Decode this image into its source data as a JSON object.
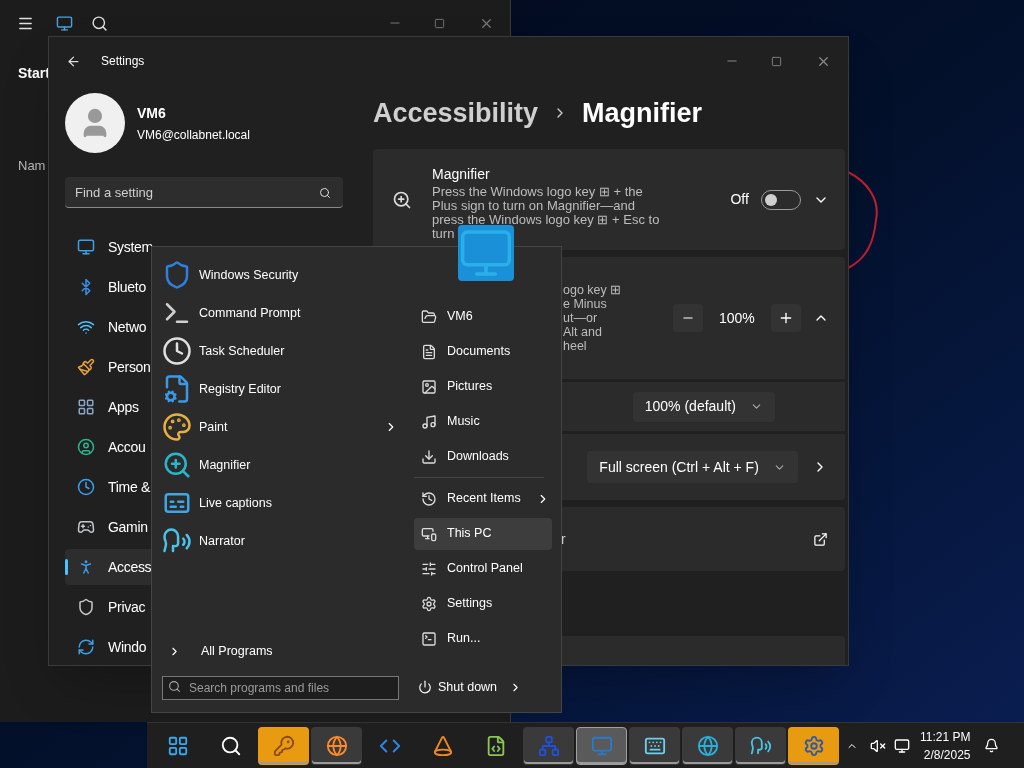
{
  "back_window": {
    "nav_heading": "Start",
    "column_heading": "Nam"
  },
  "settings": {
    "title": "Settings",
    "user": {
      "name": "VM6",
      "email": "VM6@collabnet.local"
    },
    "search": {
      "placeholder": "Find a setting"
    },
    "nav": [
      {
        "label": "System",
        "kind": "system",
        "selected": false
      },
      {
        "label": "Blueto",
        "kind": "bluetooth",
        "selected": false
      },
      {
        "label": "Netwo",
        "kind": "network",
        "selected": false
      },
      {
        "label": "Person",
        "kind": "brush",
        "selected": false
      },
      {
        "label": "Apps",
        "kind": "apps",
        "selected": false
      },
      {
        "label": "Accou",
        "kind": "account",
        "selected": false
      },
      {
        "label": "Time &",
        "kind": "time",
        "selected": false
      },
      {
        "label": "Gamin",
        "kind": "gaming",
        "selected": false
      },
      {
        "label": "Access",
        "kind": "accessibility",
        "selected": true
      },
      {
        "label": "Privac",
        "kind": "privacy",
        "selected": false
      },
      {
        "label": "Windo",
        "kind": "update",
        "selected": false
      }
    ],
    "breadcrumb": [
      "Accessibility",
      "Magnifier"
    ],
    "magnifier_card": {
      "title": "Magnifier",
      "description": "Press the Windows logo key ⊞ + the Plus sign to turn on Magnifier—and press the Windows logo key ⊞ + Esc to turn",
      "toggle_label": "Off",
      "on": false,
      "expanded": false
    },
    "zoom_card": {
      "description_lines": [
        "ogo key ⊞",
        "e Minus",
        "ut—or",
        "Alt and",
        "heel"
      ],
      "zoom_level": "100%",
      "expanded": true
    },
    "zoom_increment": {
      "value": "100% (default)"
    },
    "view": {
      "value": "Full screen (Ctrl + Alt + F)"
    },
    "link_card": {
      "label": "r"
    }
  },
  "start_menu": {
    "programs": [
      {
        "label": "Windows Security",
        "kind": "shield",
        "submenu": false
      },
      {
        "label": "Command Prompt",
        "kind": "console",
        "submenu": false
      },
      {
        "label": "Task Scheduler",
        "kind": "clock",
        "submenu": false
      },
      {
        "label": "Registry Editor",
        "kind": "registry",
        "submenu": false
      },
      {
        "label": "Paint",
        "kind": "palette",
        "submenu": true
      },
      {
        "label": "Magnifier",
        "kind": "magnifier",
        "submenu": false
      },
      {
        "label": "Live captions",
        "kind": "captions",
        "submenu": false
      },
      {
        "label": "Narrator",
        "kind": "narrator",
        "submenu": false
      }
    ],
    "all_programs": "All Programs",
    "search": {
      "placeholder": "Search programs and files"
    },
    "places": [
      {
        "label": "VM6",
        "kind": "user-folder",
        "submenu": false,
        "selected": false
      },
      {
        "label": "Documents",
        "kind": "document",
        "submenu": false,
        "selected": false
      },
      {
        "label": "Pictures",
        "kind": "picture",
        "submenu": false,
        "selected": false
      },
      {
        "label": "Music",
        "kind": "music",
        "submenu": false,
        "selected": false
      },
      {
        "label": "Downloads",
        "kind": "download",
        "submenu": false,
        "selected": false
      }
    ],
    "system_places": [
      {
        "label": "Recent Items",
        "kind": "recent",
        "submenu": true,
        "selected": false
      },
      {
        "label": "This PC",
        "kind": "computer",
        "submenu": false,
        "selected": true
      },
      {
        "label": "Control Panel",
        "kind": "control-panel",
        "submenu": false,
        "selected": false
      },
      {
        "label": "Settings",
        "kind": "settings",
        "submenu": false,
        "selected": false
      },
      {
        "label": "Run...",
        "kind": "run",
        "submenu": false,
        "selected": false
      }
    ],
    "shutdown": "Shut down"
  },
  "taskbar": {
    "apps": [
      {
        "kind": "start",
        "running": false,
        "attention": false,
        "selected": false
      },
      {
        "kind": "search",
        "running": false,
        "attention": false,
        "selected": false
      },
      {
        "kind": "key-search",
        "running": true,
        "attention": true,
        "selected": false
      },
      {
        "kind": "firefox",
        "running": true,
        "attention": false,
        "selected": false
      },
      {
        "kind": "code",
        "running": false,
        "attention": false,
        "selected": false
      },
      {
        "kind": "cone",
        "running": false,
        "attention": false,
        "selected": false
      },
      {
        "kind": "notepad",
        "running": false,
        "attention": false,
        "selected": false
      },
      {
        "kind": "m-logo",
        "running": true,
        "attention": false,
        "selected": false
      },
      {
        "kind": "monitor-app",
        "running": true,
        "attention": false,
        "selected": true
      },
      {
        "kind": "keyboard",
        "running": true,
        "attention": false,
        "selected": false
      },
      {
        "kind": "edge",
        "running": true,
        "attention": false,
        "selected": false
      },
      {
        "kind": "narrator",
        "running": true,
        "attention": false,
        "selected": false
      },
      {
        "kind": "gear-app",
        "running": true,
        "attention": true,
        "selected": false
      }
    ],
    "time": "11:21 PM",
    "date": "2/8/2025"
  }
}
